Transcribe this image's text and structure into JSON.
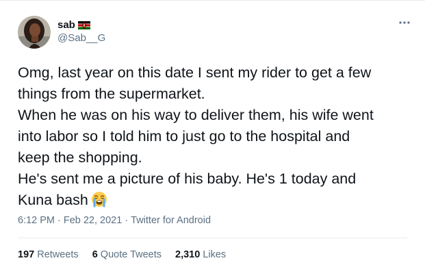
{
  "author": {
    "display_name": "sab",
    "handle": "@Sab__G",
    "flag_icon": "kenya-flag-icon"
  },
  "more_icon": "more-options-icon",
  "tweet": {
    "lines": [
      "Omg, last year on this date I sent my rider to get a few",
      "things from the supermarket.",
      "When he was on his way to deliver them, his wife went",
      "into labor so I told him to just go to the hospital and",
      "keep the shopping.",
      "He's sent me a picture of his baby. He's 1 today and",
      "Kuna bash"
    ],
    "emoji": "loudly-crying-face-emoji"
  },
  "meta": {
    "time": "6:12 PM",
    "separator": "·",
    "date": "Feb 22, 2021",
    "source": "Twitter for Android"
  },
  "stats": {
    "retweets_count": "197",
    "retweets_label": "Retweets",
    "quotes_count": "6",
    "quotes_label": "Quote Tweets",
    "likes_count": "2,310",
    "likes_label": "Likes"
  },
  "colors": {
    "text": "#0f1419",
    "secondary": "#5b7083",
    "divider": "#e6ecf0"
  }
}
